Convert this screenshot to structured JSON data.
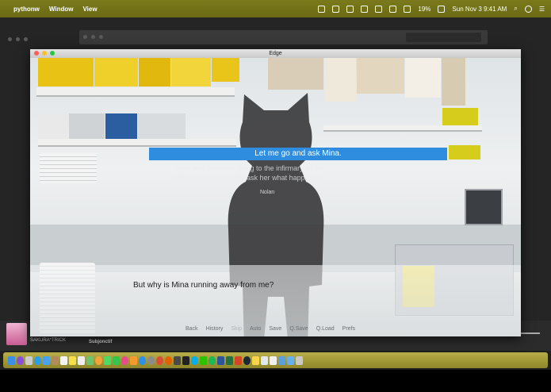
{
  "menubar": {
    "app_name": "pythonw",
    "items": [
      "Window",
      "View"
    ],
    "battery": "19%",
    "clock": "Sun Nov 3  9:41 AM"
  },
  "window": {
    "title": "Edge"
  },
  "game": {
    "selected_choice": "Let me go and ask Mina.",
    "background_line_1": "Mina was probably going to the infirmary as the",
    "background_line_2": "Drive. I should go and ask her what happened.",
    "speaker": "Nolan",
    "dialogue": "But why is Mina running away from me?",
    "quick_menu": [
      "Back",
      "History",
      "Skip",
      "Auto",
      "Save",
      "Q.Save",
      "Q.Load",
      "Prefs"
    ]
  },
  "background_app": {
    "track_artist": "SAKURA*TRICK",
    "track_title": "Subjonctif",
    "volume_label": "(((("
  },
  "colors": {
    "menubar": "#6f6e17",
    "choice_highlight": "#2f8de0",
    "dock": "#a79e3a"
  }
}
